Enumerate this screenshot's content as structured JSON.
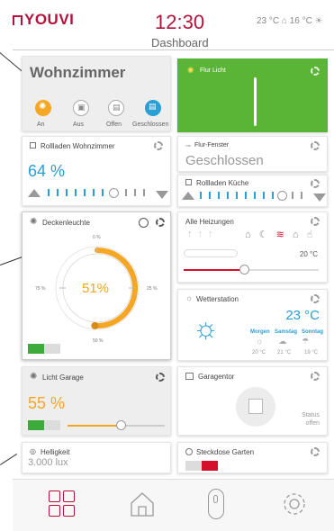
{
  "header": {
    "logo": "YOUVI",
    "time": "12:30",
    "temp_indoor": "23 °C",
    "temp_outdoor": "16 °C",
    "title": "Dashboard"
  },
  "room": {
    "title": "Wohnzimmer",
    "scenes": [
      "An",
      "Aus",
      "Offen",
      "Geschlossen"
    ]
  },
  "flur_licht": {
    "label": "Flur Licht"
  },
  "rollladen_wohnzimmer": {
    "label": "Rollladen Wohnzimmer",
    "value": "64 %"
  },
  "flur_fenster": {
    "label": "Flur-Fenster",
    "value": "Geschlossen"
  },
  "rollladen_kueche": {
    "label": "Rollladen Küche"
  },
  "deckenleuchte": {
    "label": "Deckenleuchte",
    "value": "51%",
    "level": 0.51,
    "tick_top": "0 %",
    "tick_left": "75 %",
    "tick_right": "25 %",
    "tick_bottom": "50 %"
  },
  "heizungen": {
    "label": "Alle Heizungen",
    "temp": "20 °C"
  },
  "wetter": {
    "label": "Wetterstation",
    "temp": "23 °C",
    "days": [
      "Morgen",
      "Samstag",
      "Sonntag"
    ],
    "temps": [
      "20 °C",
      "21 °C",
      "19 °C"
    ]
  },
  "licht_garage": {
    "label": "Licht Garage",
    "value": "55 %",
    "level": 0.55
  },
  "garagentor": {
    "label": "Garagentor",
    "status_label": "Status",
    "status_value": "offen"
  },
  "helligkeit": {
    "label": "Helligkeit",
    "value": "3.000 lux"
  },
  "steckdose": {
    "label": "Steckdose Garten"
  },
  "colors": {
    "brand": "#b3123a",
    "accent_blue": "#2a9fd6",
    "orange": "#f5a623",
    "green": "#3cab3c",
    "flur_green": "#5ab435"
  }
}
